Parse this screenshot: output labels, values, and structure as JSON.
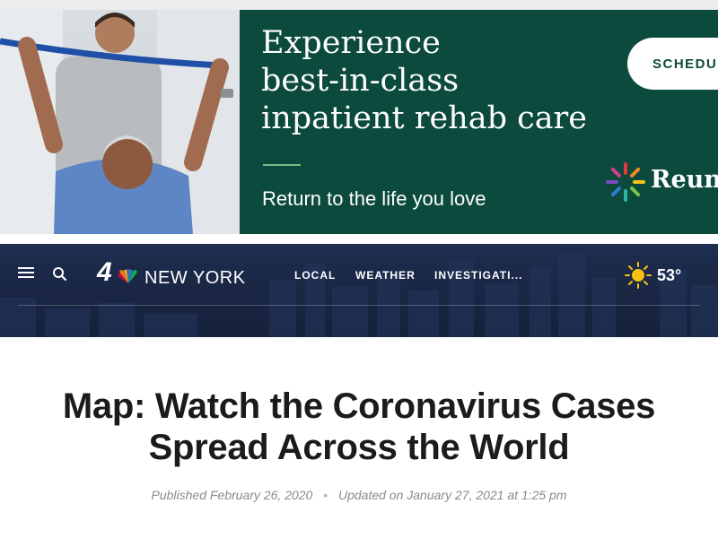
{
  "ad": {
    "headline_lines": [
      "Experience",
      "best-in-class",
      "inpatient rehab care"
    ],
    "tagline": "Return to the life you love",
    "cta_label": "SCHEDU",
    "brand": "Reun",
    "colors": {
      "panel": "#0b4a3c",
      "accent_rule": "#7fb88a"
    }
  },
  "nav": {
    "logo_number": "4",
    "logo_text": "NEW YORK",
    "links": [
      "LOCAL",
      "WEATHER",
      "INVESTIGATI..."
    ],
    "weather_temp": "53°",
    "icons": {
      "menu": "hamburger-icon",
      "search": "search-icon",
      "weather": "sun-icon"
    },
    "colors": {
      "background": "#1a2745"
    }
  },
  "article": {
    "headline": "Map: Watch the Coronavirus Cases Spread Across the World",
    "published": "Published February 26, 2020",
    "separator": "•",
    "updated": "Updated on January 27, 2021 at 1:25 pm"
  }
}
